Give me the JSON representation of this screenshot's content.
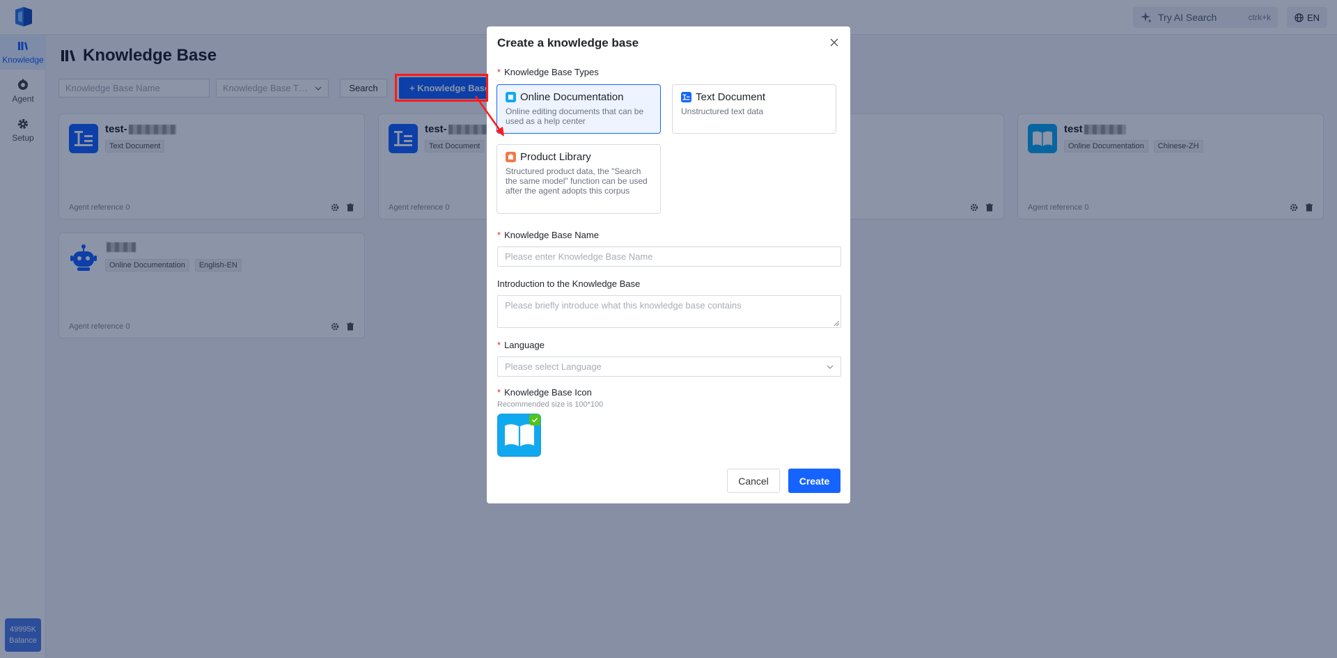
{
  "topbar": {
    "ai_search_label": "Try AI Search",
    "ai_search_shortcut": "ctrk+k",
    "language": "EN"
  },
  "sidebar": {
    "items": [
      {
        "label": "Knowledge",
        "icon": "library-icon",
        "active": true
      },
      {
        "label": "Agent",
        "icon": "agent-icon",
        "active": false
      },
      {
        "label": "Setup",
        "icon": "gear-icon",
        "active": false
      }
    ],
    "balance_amount": "49995K",
    "balance_label": "Balance"
  },
  "page": {
    "title": "Knowledge Base",
    "filter_name_placeholder": "Knowledge Base Name",
    "filter_type_placeholder": "Knowledge Base T…",
    "search_label": "Search",
    "add_button_label": "+ Knowledge Base"
  },
  "cards": [
    {
      "title": "test-",
      "tags": [
        "Text Document"
      ],
      "ref": "Agent reference 0",
      "icon": "text-document-icon"
    },
    {
      "title": "test-",
      "tags": [
        "Text Document"
      ],
      "ref": "Agent reference 0",
      "icon": "text-document-icon"
    },
    {
      "title": "",
      "tags": [],
      "ref": "",
      "icon": ""
    },
    {
      "title": "test",
      "tags": [
        "Online Documentation",
        "Chinese-ZH"
      ],
      "ref": "Agent reference 0",
      "icon": "book-icon"
    },
    {
      "title": "",
      "tags": [
        "Online Documentation",
        "English-EN"
      ],
      "ref": "Agent reference 0",
      "icon": "robot-icon"
    }
  ],
  "modal": {
    "title": "Create a knowledge base",
    "types_label": "Knowledge Base Types",
    "types": [
      {
        "title": "Online Documentation",
        "desc": "Online editing documents that can be used as a help center",
        "selected": true,
        "color": "#10a9f0"
      },
      {
        "title": "Text Document",
        "desc": "Unstructured text data",
        "selected": false,
        "color": "#1664ff"
      },
      {
        "title": "Product Library",
        "desc": "Structured product data, the \"Search the same model\" function can be used after the agent adopts this corpus",
        "selected": false,
        "color": "#f07a4a"
      }
    ],
    "name_label": "Knowledge Base Name",
    "name_placeholder": "Please enter Knowledge Base Name",
    "intro_label": "Introduction to the Knowledge Base",
    "intro_placeholder": "Please briefly introduce what this knowledge base contains",
    "language_label": "Language",
    "language_placeholder": "Please select Language",
    "icon_label": "Knowledge Base Icon",
    "icon_hint": "Recommended size is 100*100",
    "cancel_label": "Cancel",
    "create_label": "Create"
  },
  "colors": {
    "primary": "#1664ff",
    "highlight": "#ff1a1a",
    "required": "#f5222d"
  }
}
